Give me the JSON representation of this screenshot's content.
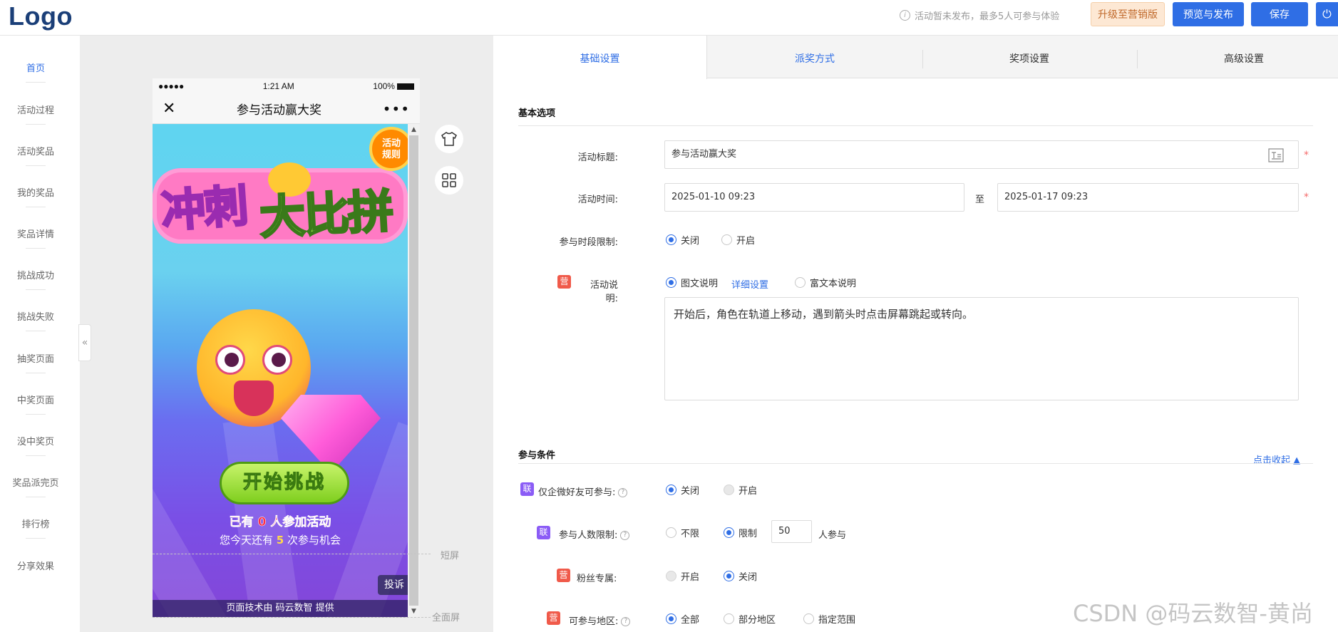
{
  "header": {
    "logo": "Logo",
    "notice": "活动暂未发布，最多5人可参与体验",
    "upgrade_label": "升级至营销版",
    "preview_label": "预览与发布",
    "save_label": "保存",
    "power_icon": "⏻"
  },
  "sidebar": {
    "items": [
      {
        "label": "首页",
        "active": true
      },
      {
        "label": "活动过程"
      },
      {
        "label": "活动奖品"
      },
      {
        "label": "我的奖品"
      },
      {
        "label": "奖品详情"
      },
      {
        "label": "挑战成功"
      },
      {
        "label": "挑战失败"
      },
      {
        "label": "抽奖页面"
      },
      {
        "label": "中奖页面"
      },
      {
        "label": "没中奖页"
      },
      {
        "label": "奖品派完页"
      },
      {
        "label": "排行榜"
      },
      {
        "label": "分享效果"
      }
    ],
    "collapse_icon": "«"
  },
  "phone": {
    "signal": "●●●●●",
    "time": "1:21 AM",
    "battery": "100%",
    "close_icon": "✕",
    "title": "参与活动赢大奖",
    "more_icon": "•••",
    "badge": "活动\n规则",
    "game_title_a": "冲刺",
    "game_title_b": "大比拼",
    "start_button": "开始挑战",
    "participants": "已有 0 人参加活动",
    "chances_prefix": "您今天还有 ",
    "chances_num": "5",
    "chances_suffix": " 次参与机会",
    "report": "投诉",
    "footer": "页面技术由 码云数智 提供"
  },
  "markers": {
    "short_screen": "短屏",
    "full_screen": "全面屏"
  },
  "tabs": [
    {
      "label": "基础设置",
      "active": true
    },
    {
      "label": "派奖方式"
    },
    {
      "label": "奖项设置"
    },
    {
      "label": "高级设置"
    }
  ],
  "basic": {
    "section_title": "基本选项",
    "title_label": "活动标题:",
    "title_value": "参与活动赢大奖",
    "time_label": "活动时间:",
    "start_time": "2025-01-10 09:23",
    "to": "至",
    "end_time": "2025-01-17 09:23",
    "period_label": "参与时段限制:",
    "period_off": "关闭",
    "period_on": "开启",
    "desc_tag": "营",
    "desc_label": "活动说明:",
    "desc_type_a": "图文说明",
    "desc_detail_link": "详细设置",
    "desc_type_b": "富文本说明",
    "desc_text": "开始后，角色在轨道上移动，遇到箭头时点击屏幕跳起或转向。",
    "required_mark": "*"
  },
  "conditions": {
    "section_title": "参与条件",
    "collapse_link": "点击收起 ▲",
    "wechat_tag": "联",
    "wechat_label": "仅企微好友可参与:",
    "wechat_off": "关闭",
    "wechat_on": "开启",
    "count_tag": "联",
    "count_label": "参与人数限制:",
    "count_unlimited": "不限",
    "count_limited": "限制",
    "count_value": "50",
    "count_suffix": "人参与",
    "fans_tag": "营",
    "fans_label": "粉丝专属:",
    "fans_on": "开启",
    "fans_off": "关闭",
    "region_tag": "营",
    "region_label": "可参与地区:",
    "region_all": "全部",
    "region_part": "部分地区",
    "region_range": "指定范围"
  },
  "watermark": "CSDN @码云数智-黄尚",
  "colors": {
    "accent": "#2f6ee5",
    "upgrade_bg": "#fde8d4",
    "tag_ying": "#f05a4a",
    "tag_lian": "#8b5cf6"
  }
}
